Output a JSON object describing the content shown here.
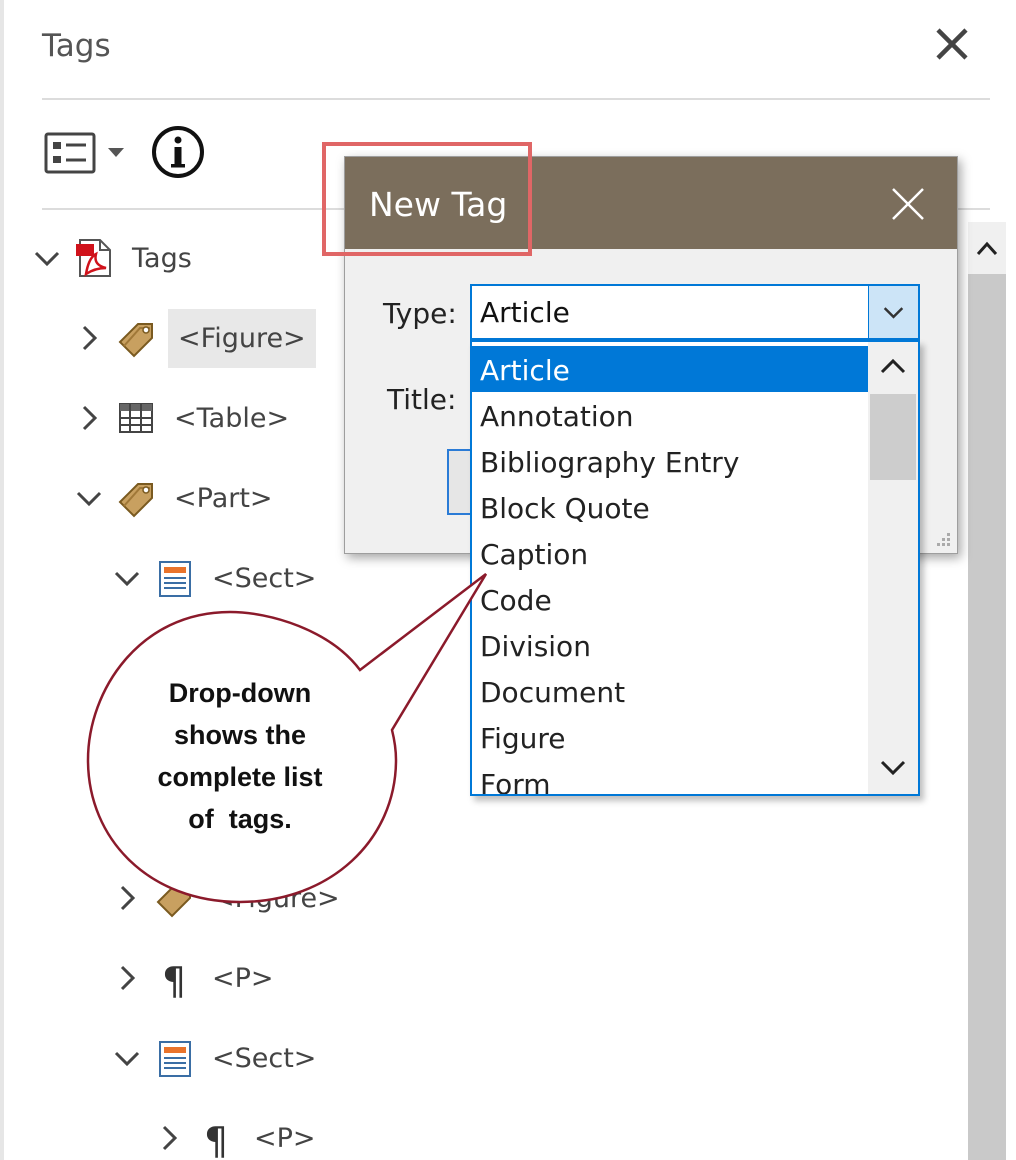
{
  "panel": {
    "title": "Tags",
    "close_label": "×"
  },
  "toolbar": {
    "options_icon": "list-options-icon",
    "info_icon": "info-icon"
  },
  "tree": {
    "items": [
      {
        "label": "Tags",
        "icon": "pdf-icon",
        "expanded": true
      },
      {
        "label": "<Figure>",
        "icon": "tag-icon",
        "expanded": false,
        "selected": true
      },
      {
        "label": "<Table>",
        "icon": "table-icon",
        "expanded": false
      },
      {
        "label": "<Part>",
        "icon": "tag-icon",
        "expanded": true
      },
      {
        "label": "<Sect>",
        "icon": "section-icon",
        "expanded": true
      },
      {
        "label": "<Figure>",
        "icon": "tag-icon",
        "expanded": false
      },
      {
        "label": "<P>",
        "icon": "paragraph-icon",
        "expanded": false
      },
      {
        "label": "<Sect>",
        "icon": "section-icon",
        "expanded": true
      },
      {
        "label": "<P>",
        "icon": "paragraph-icon",
        "expanded": false
      }
    ]
  },
  "dialog": {
    "title": "New Tag",
    "type_label": "Type:",
    "title_label": "Title:",
    "type_value": "Article"
  },
  "dropdown": {
    "options": [
      "Article",
      "Annotation",
      "Bibliography Entry",
      "Block Quote",
      "Caption",
      "Code",
      "Division",
      "Document",
      "Figure",
      "Form"
    ],
    "selected": "Article"
  },
  "callout": {
    "lines": [
      "Drop-down",
      "shows the",
      "complete list",
      "of  tags."
    ]
  },
  "colors": {
    "dialog_titlebar": "#7b6e5c",
    "selection": "#0078d7",
    "highlight_box": "#e06666",
    "callout_border": "#8b1a2b"
  }
}
